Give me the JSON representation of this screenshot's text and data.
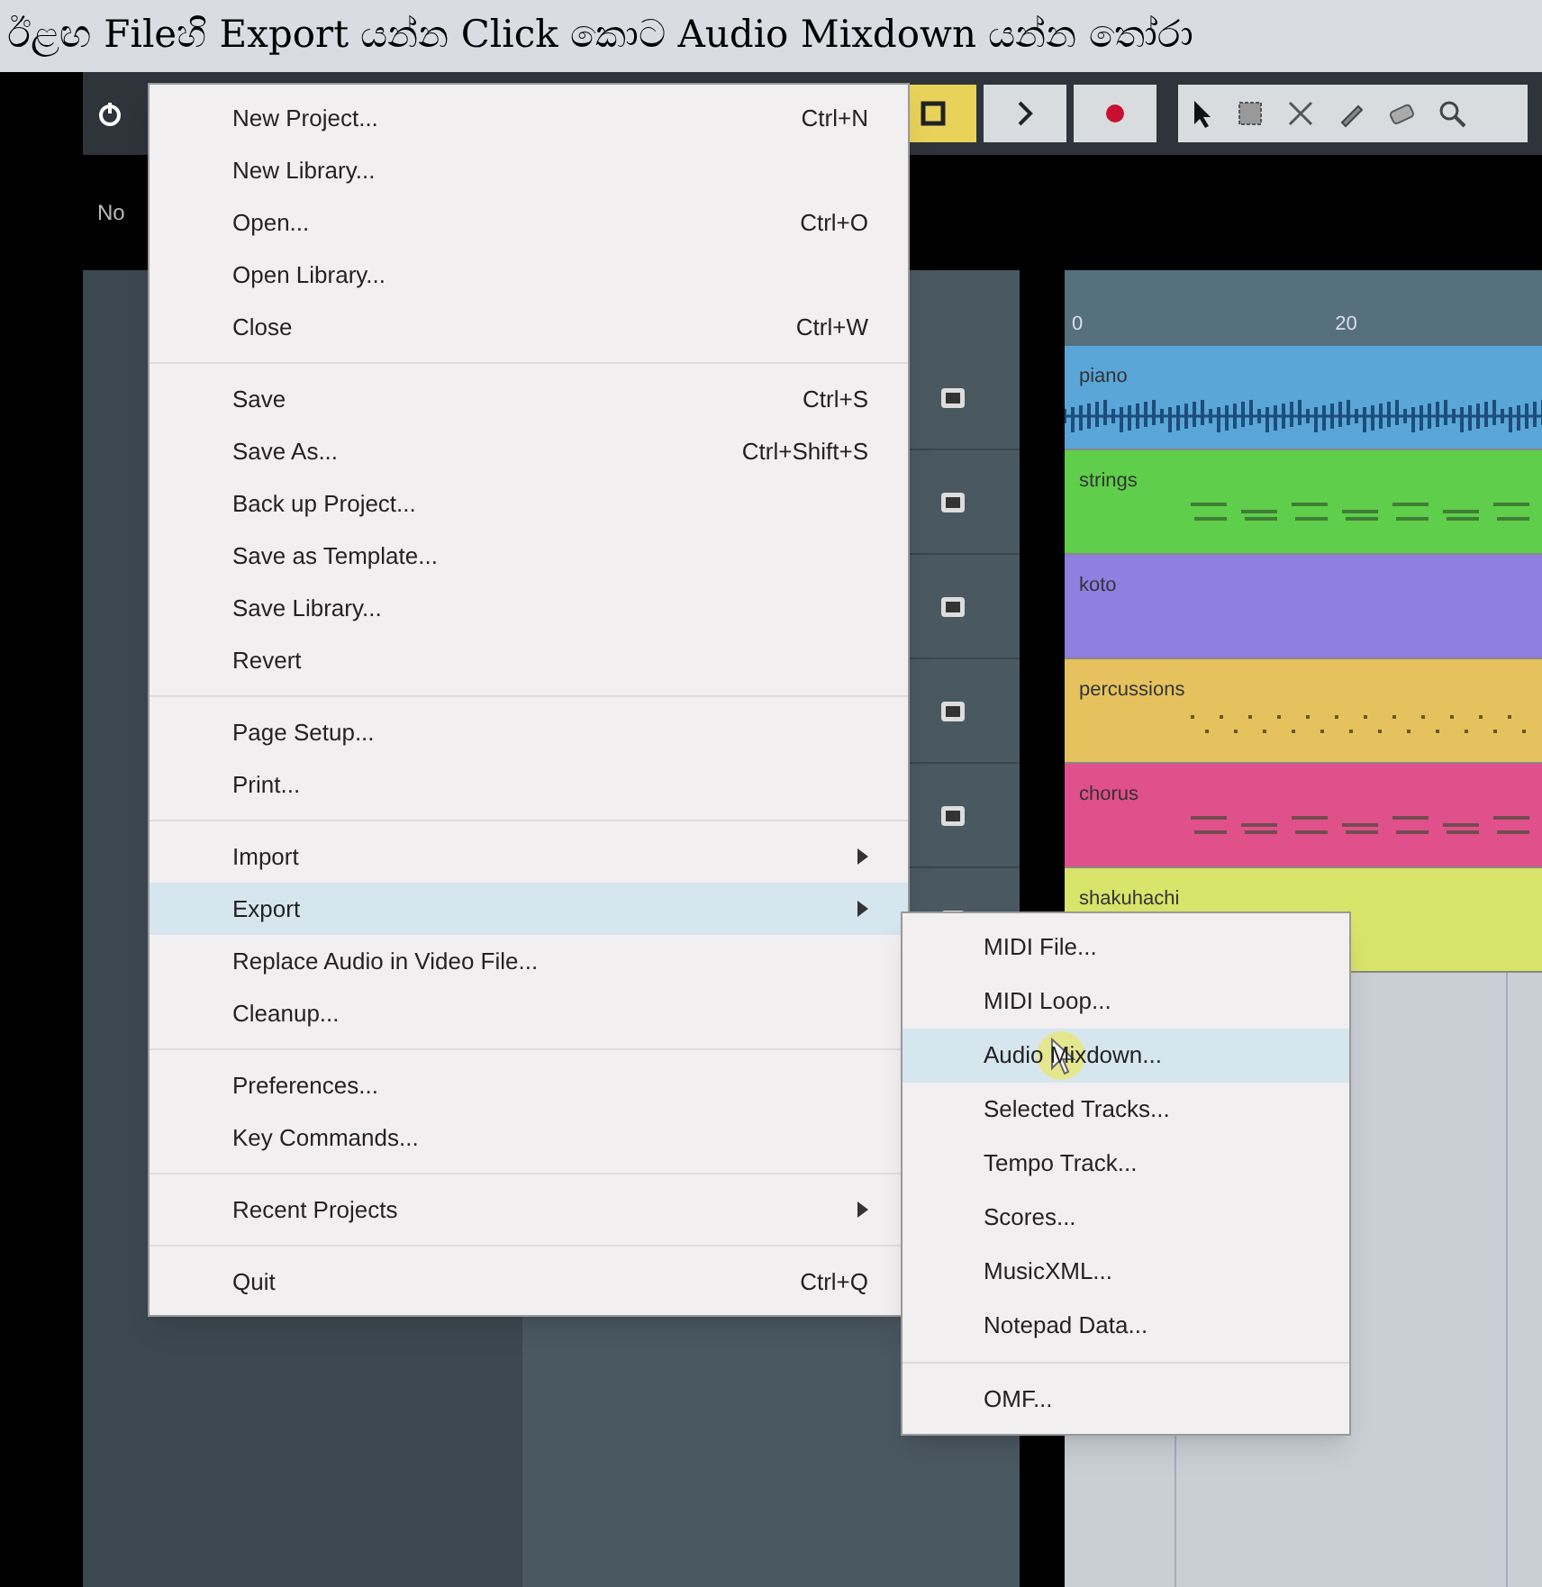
{
  "caption": "ඊළඟ Fileහි Export යන්න Click කොට Audio Mixdown යන්න තෝරා",
  "info_line": {
    "text": "No"
  },
  "ruler": {
    "labels": [
      "0",
      "20"
    ]
  },
  "tracks": [
    {
      "name": "piano",
      "color": "#5aa6d8",
      "kind": "wave"
    },
    {
      "name": "strings",
      "color": "#5fce4a",
      "kind": "midi"
    },
    {
      "name": "koto",
      "color": "#8f7fe0",
      "kind": "empty"
    },
    {
      "name": "percussions",
      "color": "#e6c25e",
      "kind": "dots"
    },
    {
      "name": "chorus",
      "color": "#e0508a",
      "kind": "midi"
    },
    {
      "name": "shakuhachi",
      "color": "#d8e46a",
      "kind": "empty"
    }
  ],
  "file_menu": {
    "groups": [
      [
        {
          "label": "New Project...",
          "shortcut": "Ctrl+N",
          "submenu": false,
          "selected": false
        },
        {
          "label": "New Library...",
          "submenu": false,
          "selected": false
        },
        {
          "label": "Open...",
          "shortcut": "Ctrl+O",
          "submenu": false,
          "selected": false
        },
        {
          "label": "Open Library...",
          "submenu": false,
          "selected": false
        },
        {
          "label": "Close",
          "shortcut": "Ctrl+W",
          "submenu": false,
          "selected": false
        }
      ],
      [
        {
          "label": "Save",
          "shortcut": "Ctrl+S",
          "submenu": false,
          "selected": false
        },
        {
          "label": "Save As...",
          "shortcut": "Ctrl+Shift+S",
          "submenu": false,
          "selected": false
        },
        {
          "label": "Back up Project...",
          "submenu": false,
          "selected": false
        },
        {
          "label": "Save as Template...",
          "submenu": false,
          "selected": false
        },
        {
          "label": "Save Library...",
          "submenu": false,
          "selected": false
        },
        {
          "label": "Revert",
          "submenu": false,
          "selected": false
        }
      ],
      [
        {
          "label": "Page Setup...",
          "submenu": false,
          "selected": false
        },
        {
          "label": "Print...",
          "submenu": false,
          "selected": false
        }
      ],
      [
        {
          "label": "Import",
          "submenu": true,
          "selected": false
        },
        {
          "label": "Export",
          "submenu": true,
          "selected": true
        },
        {
          "label": "Replace Audio in Video File...",
          "submenu": false,
          "selected": false
        },
        {
          "label": "Cleanup...",
          "submenu": false,
          "selected": false
        }
      ],
      [
        {
          "label": "Preferences...",
          "submenu": false,
          "selected": false
        },
        {
          "label": "Key Commands...",
          "submenu": false,
          "selected": false
        }
      ],
      [
        {
          "label": "Recent Projects",
          "submenu": true,
          "selected": false
        }
      ],
      [
        {
          "label": "Quit",
          "shortcut": "Ctrl+Q",
          "submenu": false,
          "selected": false
        }
      ]
    ]
  },
  "export_submenu": {
    "groups": [
      [
        {
          "label": "MIDI File...",
          "selected": false
        },
        {
          "label": "MIDI Loop...",
          "selected": false
        },
        {
          "label": "Audio Mixdown...",
          "selected": true
        },
        {
          "label": "Selected Tracks...",
          "selected": false
        },
        {
          "label": "Tempo Track...",
          "selected": false
        },
        {
          "label": "Scores...",
          "selected": false
        },
        {
          "label": "MusicXML...",
          "selected": false
        },
        {
          "label": "Notepad Data...",
          "selected": false
        }
      ],
      [
        {
          "label": "OMF...",
          "selected": false
        }
      ]
    ]
  }
}
